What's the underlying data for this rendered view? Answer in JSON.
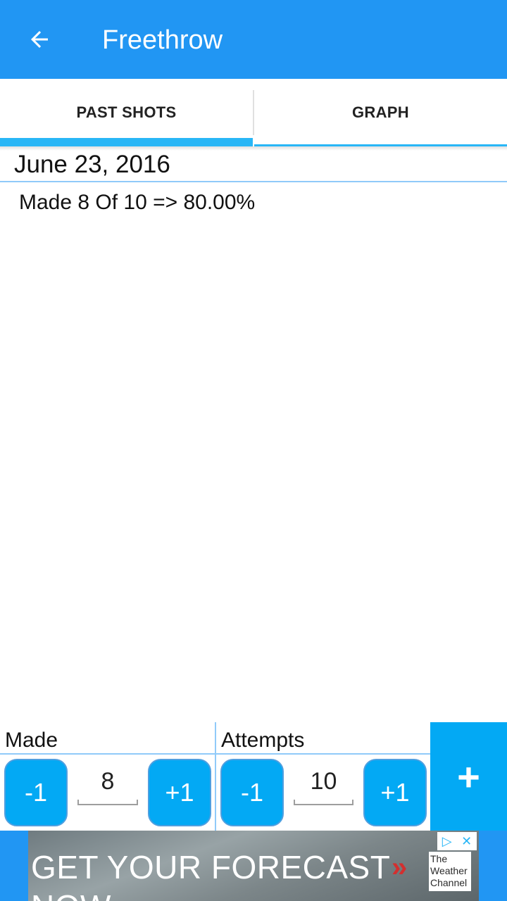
{
  "appbar": {
    "title": "Freethrow",
    "back_icon": "arrow-back-icon"
  },
  "tabs": [
    {
      "label": "PAST SHOTS",
      "selected": true
    },
    {
      "label": "GRAPH",
      "selected": false
    }
  ],
  "history": {
    "date": "June 23, 2016",
    "records": [
      "Made 8 Of 10 => 80.00%"
    ]
  },
  "counter": {
    "made": {
      "label": "Made",
      "minus_label": "-1",
      "value": "8",
      "plus_label": "+1"
    },
    "attempts": {
      "label": "Attempts",
      "minus_label": "-1",
      "value": "10",
      "plus_label": "+1"
    },
    "add_label": "+"
  },
  "ad": {
    "headline": "GET YOUR FORECAST NOW",
    "chevron": "»",
    "logo_lines": [
      "The",
      "Weather",
      "Channel"
    ],
    "choices_icon": "▷",
    "close_icon": "✕"
  },
  "colors": {
    "primary": "#2196F3",
    "accent": "#03A9F4",
    "indicator": "#29b6f6"
  }
}
